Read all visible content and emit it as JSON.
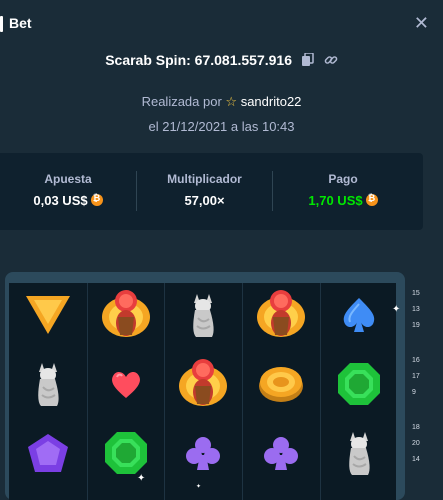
{
  "header": {
    "title": "Bet",
    "close_icon": "close-icon"
  },
  "game": {
    "title": "Scarab Spin: 67.081.557.916"
  },
  "placed_by": {
    "prefix": "Realizada por",
    "username": "sandrito22"
  },
  "date": "el 21/12/2021 a las 10:43",
  "stats": {
    "bet_label": "Apuesta",
    "bet_value": "0,03 US$",
    "multiplier_label": "Multiplicador",
    "multiplier_value": "57,00×",
    "payout_label": "Pago",
    "payout_value": "1,70 US$"
  },
  "colors": {
    "background": "#1a2c38",
    "panel": "#0f212e",
    "payout": "#00e701",
    "coin": "#f7931a"
  },
  "reels": [
    [
      "triangle-gem",
      "scarab",
      "cat-statue",
      "scarab",
      "spade"
    ],
    [
      "cat-statue",
      "heart",
      "scarab",
      "gold-coin",
      "emerald"
    ],
    [
      "amethyst",
      "emerald",
      "club",
      "club",
      "cat-statue"
    ]
  ],
  "paylines": [
    "15",
    "13",
    "19",
    "16",
    "17",
    "9",
    "18",
    "20",
    "14"
  ]
}
